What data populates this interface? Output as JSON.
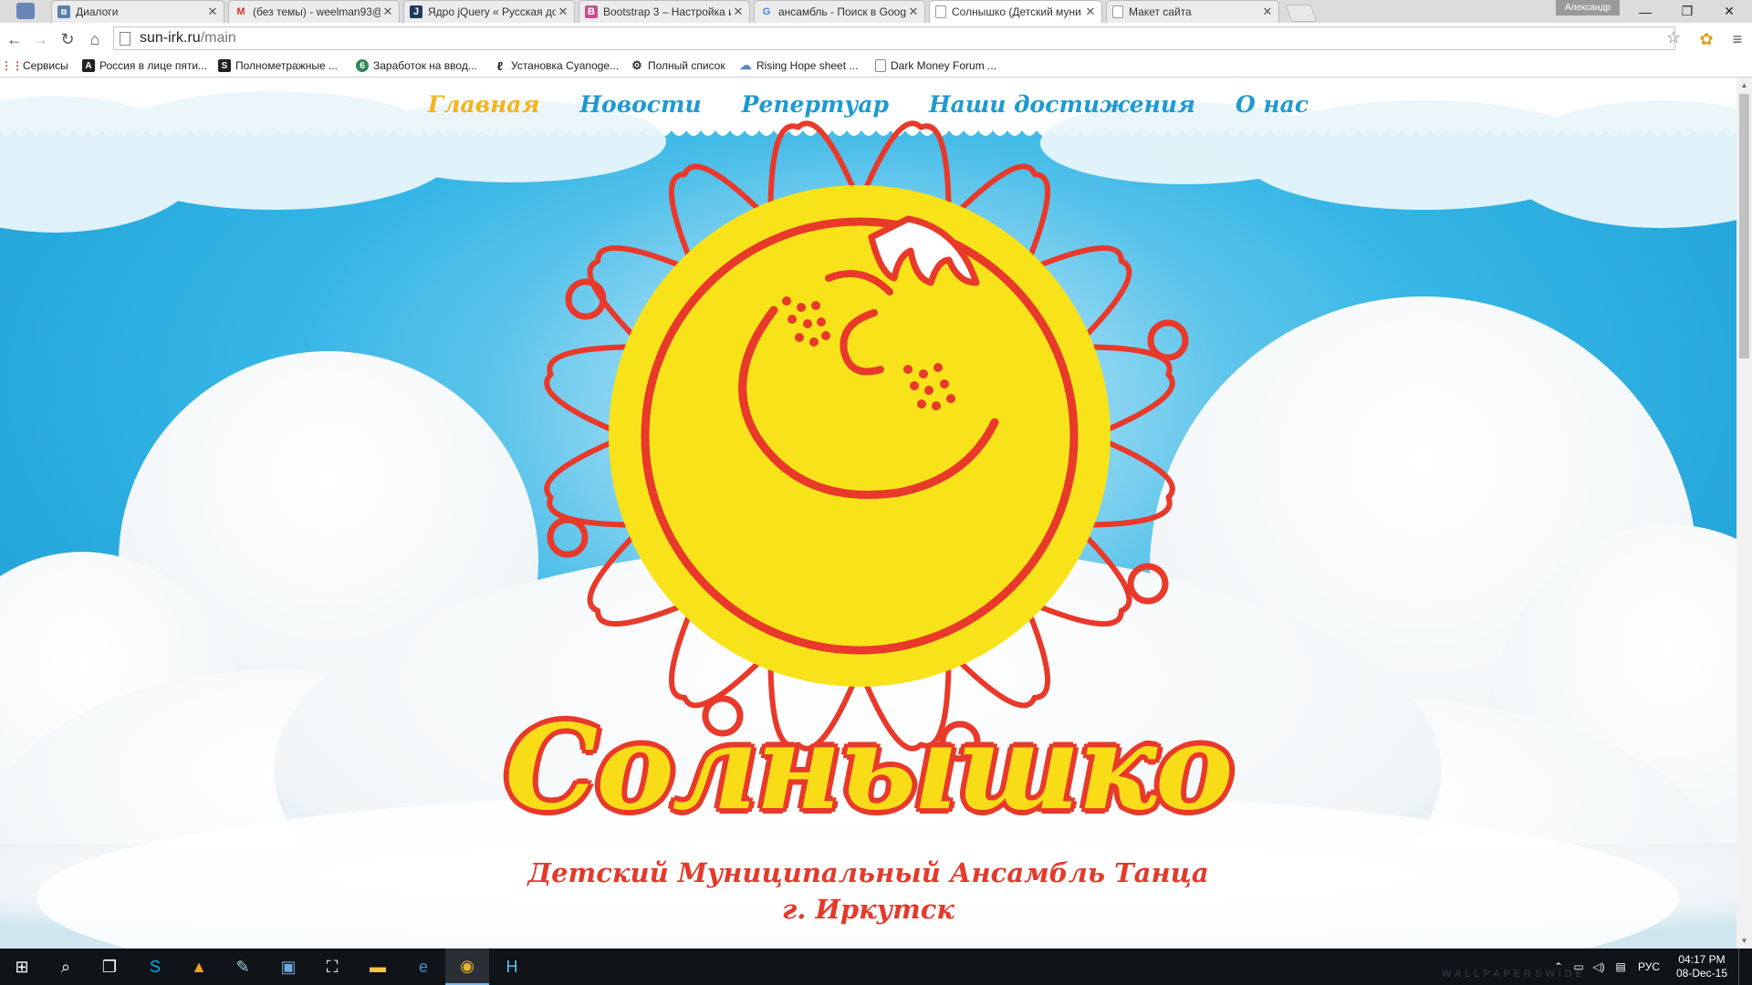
{
  "browser": {
    "tabs": [
      {
        "title": "Диалоги",
        "icon": "vk-icon",
        "active": false
      },
      {
        "title": "(без темы) - weelman93@",
        "icon": "gmail-icon",
        "active": false
      },
      {
        "title": "Ядро jQuery « Русская до",
        "icon": "jquery-icon",
        "active": false
      },
      {
        "title": "Bootstrap 3 – Настройка и",
        "icon": "bootstrap-icon",
        "active": false
      },
      {
        "title": "ансамбль - Поиск в Goog",
        "icon": "google-icon",
        "active": false
      },
      {
        "title": "Солнышко (Детский муни",
        "icon": "page-icon",
        "active": true
      },
      {
        "title": "Макет сайта",
        "icon": "page-icon",
        "active": false
      }
    ],
    "user_name": "Александр",
    "address": {
      "domain": "sun-irk.ru",
      "path": "/main"
    },
    "bookmarks": [
      {
        "label": "Сервисы",
        "icon": "apps-icon"
      },
      {
        "label": "Россия в лице пяти...",
        "icon": "a-letter-icon"
      },
      {
        "label": "Полнометражные ...",
        "icon": "s-letter-icon"
      },
      {
        "label": "Заработок на ввод...",
        "icon": "circle-6-icon"
      },
      {
        "label": "Установка Cyanoge...",
        "icon": "bottle-icon"
      },
      {
        "label": "Полный список",
        "icon": "gear-person-icon"
      },
      {
        "label": "Rising Hope sheet ...",
        "icon": "cloud-icon"
      },
      {
        "label": "Dark Money Forum ...",
        "icon": "bookmark-page-icon"
      }
    ]
  },
  "site": {
    "nav": [
      {
        "label": "Главная",
        "active": true
      },
      {
        "label": "Новости",
        "active": false
      },
      {
        "label": "Репертуар",
        "active": false
      },
      {
        "label": "Наши достижения",
        "active": false
      },
      {
        "label": "О нас",
        "active": false
      }
    ],
    "title": "Солнышко",
    "subtitle_line1": "Детский Муниципальный Ансамбль Танца",
    "subtitle_line2": "г. Иркутск",
    "colors": {
      "sky": "#17a6dc",
      "sun": "#f8e31a",
      "sun_outline": "#e8392a",
      "nav_active": "#f4b41a",
      "nav_link": "#1e9ad1"
    }
  },
  "taskbar": {
    "lang": "РУС",
    "time": "04:17 PM",
    "date": "08-Dec-15",
    "watermark": "WALLPAPERSWIDE"
  }
}
